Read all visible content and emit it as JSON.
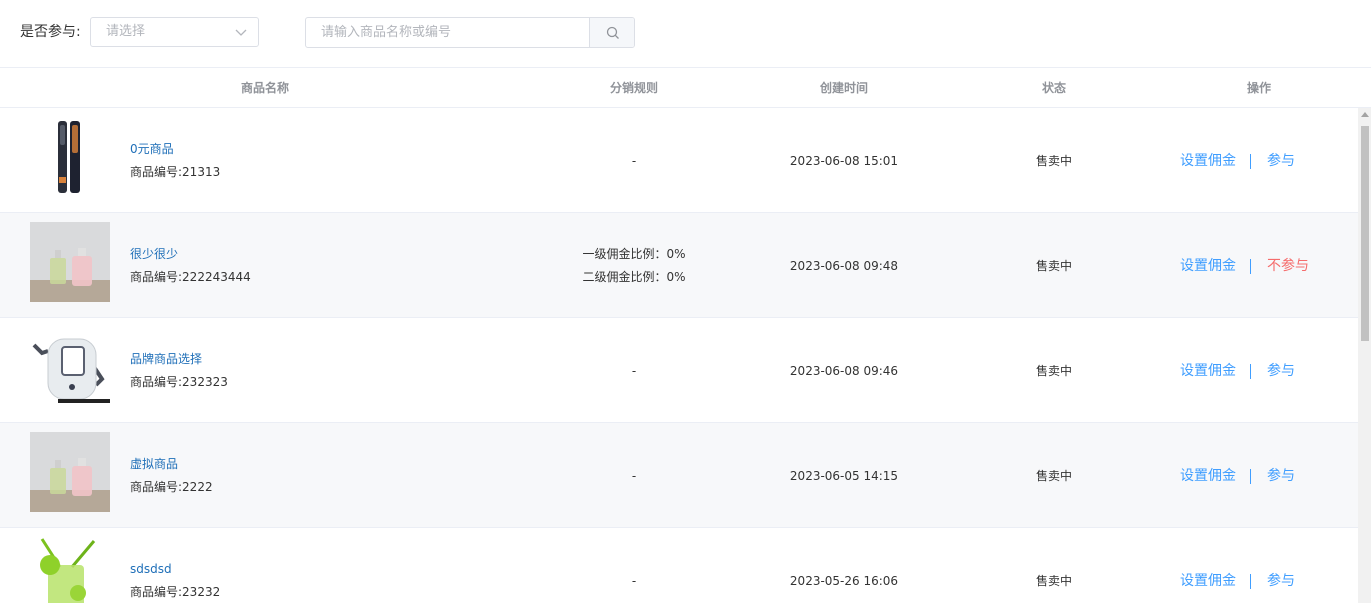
{
  "filter": {
    "label": "是否参与:",
    "select_placeholder": "请选择",
    "search_placeholder": "请输入商品名称或编号"
  },
  "table": {
    "headers": [
      "商品名称",
      "分销规则",
      "创建时间",
      "状态",
      "操作"
    ],
    "rows": [
      {
        "name": "0元商品",
        "code": "商品编号:21313",
        "rule1": "-",
        "rule2": "",
        "time": "2023-06-08 15:01",
        "status": "售卖中",
        "action_set": "设置佣金",
        "action_join": "参与",
        "thumb": "hair-straightener-icon"
      },
      {
        "name": "很少很少",
        "code": "商品编号:222243444",
        "rule1": "一级佣金比例：0%",
        "rule2": "二级佣金比例：0%",
        "time": "2023-06-08 09:48",
        "status": "售卖中",
        "action_set": "设置佣金",
        "action_join": "不参与",
        "thumb": "perfume-bottles-icon"
      },
      {
        "name": "品牌商品选择",
        "code": "商品编号:232323",
        "rule1": "-",
        "rule2": "",
        "time": "2023-06-08 09:46",
        "status": "售卖中",
        "action_set": "设置佣金",
        "action_join": "参与",
        "thumb": "robot-icon"
      },
      {
        "name": "虚拟商品",
        "code": "商品编号:2222",
        "rule1": "-",
        "rule2": "",
        "time": "2023-06-05 14:15",
        "status": "售卖中",
        "action_set": "设置佣金",
        "action_join": "参与",
        "thumb": "perfume-bottles-icon"
      },
      {
        "name": "sdsdsd",
        "code": "商品编号:23232",
        "rule1": "-",
        "rule2": "",
        "time": "2023-05-26 16:06",
        "status": "售卖中",
        "action_set": "设置佣金",
        "action_join": "参与",
        "thumb": "lime-drink-icon"
      }
    ]
  },
  "colors": {
    "link": "#409eff",
    "danger": "#f56c6c",
    "name_link": "#1f6fb8",
    "row_alt": "#f7f8fa"
  }
}
